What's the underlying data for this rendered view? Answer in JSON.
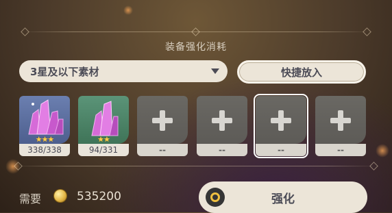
{
  "panel": {
    "title": "装备强化消耗"
  },
  "filter": {
    "selected": "3星及以下素材",
    "caret_icon": "chevron-down-icon"
  },
  "quick_add": {
    "label": "快捷放入"
  },
  "slots": [
    {
      "type": "material",
      "icon": "pink-crystal-icon",
      "rarity_stars": 3,
      "stars_text": "★★★",
      "count": "338/338",
      "bg_color": "#5a6d9a"
    },
    {
      "type": "material",
      "icon": "pink-crystal-icon",
      "rarity_stars": 2,
      "stars_text": "★★",
      "count": "94/331",
      "bg_color": "#4a7d63"
    },
    {
      "type": "empty",
      "icon": "plus-icon",
      "count": "--"
    },
    {
      "type": "empty",
      "icon": "plus-icon",
      "count": "--"
    },
    {
      "type": "empty",
      "icon": "plus-icon",
      "count": "--",
      "selected": true
    },
    {
      "type": "empty",
      "icon": "plus-icon",
      "count": "--"
    }
  ],
  "cost": {
    "label": "需要",
    "currency_icon": "mora-coin-icon",
    "amount": "535200"
  },
  "enhance_button": {
    "label": "强化",
    "icon": "enhance-icon"
  },
  "colors": {
    "button_bg": "#ece5d8",
    "button_text": "#4b4b56",
    "star_gold": "#ffcf4a",
    "coin_gold": "#e5b94a"
  }
}
